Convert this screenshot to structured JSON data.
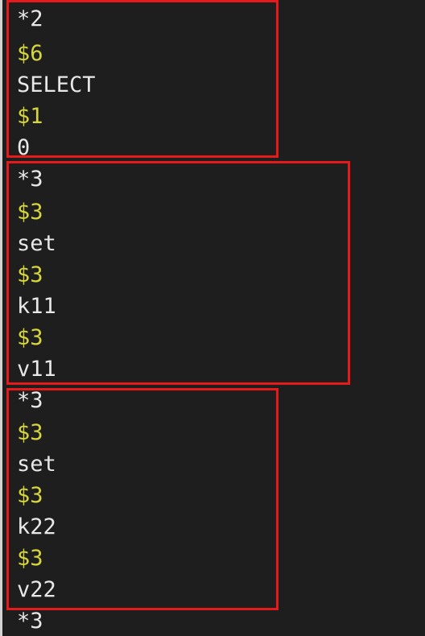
{
  "editor": {
    "lines": [
      {
        "text": "*2",
        "kind": "array-header"
      },
      {
        "text": "$6",
        "kind": "length"
      },
      {
        "text": "SELECT",
        "kind": "value"
      },
      {
        "text": "$1",
        "kind": "length"
      },
      {
        "text": "0",
        "kind": "value"
      },
      {
        "text": "*3",
        "kind": "array-header"
      },
      {
        "text": "$3",
        "kind": "length"
      },
      {
        "text": "set",
        "kind": "value"
      },
      {
        "text": "$3",
        "kind": "length"
      },
      {
        "text": "k11",
        "kind": "value"
      },
      {
        "text": "$3",
        "kind": "length"
      },
      {
        "text": "v11",
        "kind": "value"
      },
      {
        "text": "*3",
        "kind": "array-header"
      },
      {
        "text": "$3",
        "kind": "length"
      },
      {
        "text": "set",
        "kind": "value"
      },
      {
        "text": "$3",
        "kind": "length"
      },
      {
        "text": "k22",
        "kind": "value"
      },
      {
        "text": "$3",
        "kind": "length"
      },
      {
        "text": "v22",
        "kind": "value"
      },
      {
        "text": "*3",
        "kind": "array-header"
      }
    ]
  },
  "colors": {
    "background": "#1e1e1e",
    "text": "#e8e8e8",
    "length_prefix": "#d7d73c",
    "highlight_box": "#e51a1a"
  }
}
